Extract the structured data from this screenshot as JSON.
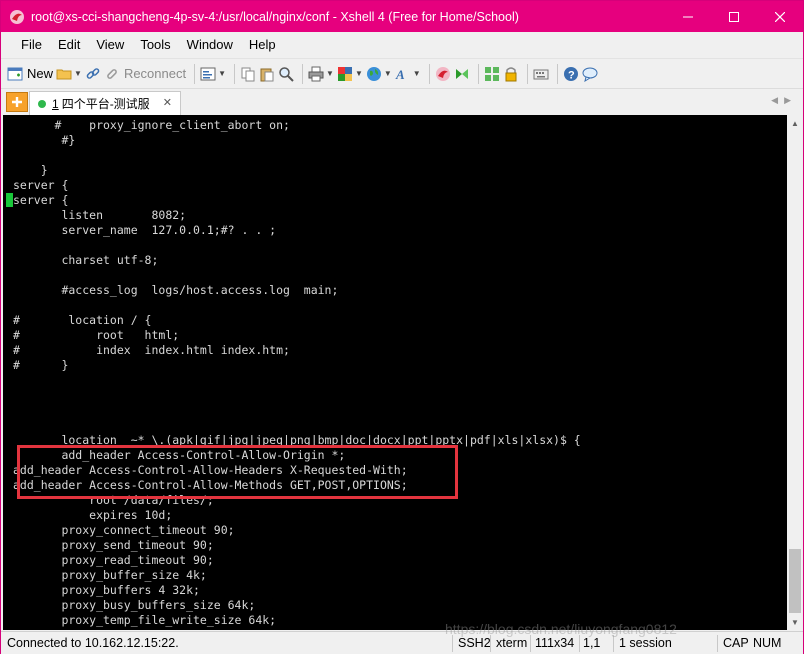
{
  "window": {
    "title": "root@xs-cci-shangcheng-4p-sv-4:/usr/local/nginx/conf - Xshell 4 (Free for Home/School)",
    "accent_color": "#e6007e"
  },
  "menu": [
    "File",
    "Edit",
    "View",
    "Tools",
    "Window",
    "Help"
  ],
  "toolbar": {
    "new_label": "New",
    "reconnect_label": "Reconnect"
  },
  "tab": {
    "number": "1",
    "label": "四个平台-测试服",
    "status_color": "#2fb84c"
  },
  "terminal": {
    "lines": [
      "      #    proxy_ignore_client_abort on;",
      "       #}",
      "",
      "    }",
      "server {",
      "server {",
      "       listen       8082;",
      "       server_name  127.0.0.1;#? . . ;",
      "",
      "       charset utf-8;",
      "",
      "       #access_log  logs/host.access.log  main;",
      "",
      "#       location / {",
      "#           root   html;",
      "#           index  index.html index.htm;",
      "#      }",
      "",
      "",
      "",
      "",
      "       location  ~* \\.(apk|gif|jpg|jpeg|png|bmp|doc|docx|ppt|pptx|pdf|xls|xlsx)$ {",
      "       add_header Access-Control-Allow-Origin *;",
      "add_header Access-Control-Allow-Headers X-Requested-With;",
      "add_header Access-Control-Allow-Methods GET,POST,OPTIONS;",
      "           root /data/files/;",
      "           expires 10d;",
      "       proxy_connect_timeout 90;",
      "       proxy_send_timeout 90;",
      "       proxy_read_timeout 90;",
      "       proxy_buffer_size 4k;",
      "       proxy_buffers 4 32k;",
      "       proxy_busy_buffers_size 64k;",
      "       proxy_temp_file_write_size 64k;"
    ]
  },
  "status": {
    "connection": "Connected to 10.162.12.15:22.",
    "protocol": "SSH2",
    "terminal_type": "xterm",
    "size": "111x34",
    "cursor_pos": "1,1",
    "sessions": "1 session",
    "caps": "CAP",
    "num": "NUM"
  },
  "watermark": "https://blog.csdn.net/liuyongfang0812"
}
